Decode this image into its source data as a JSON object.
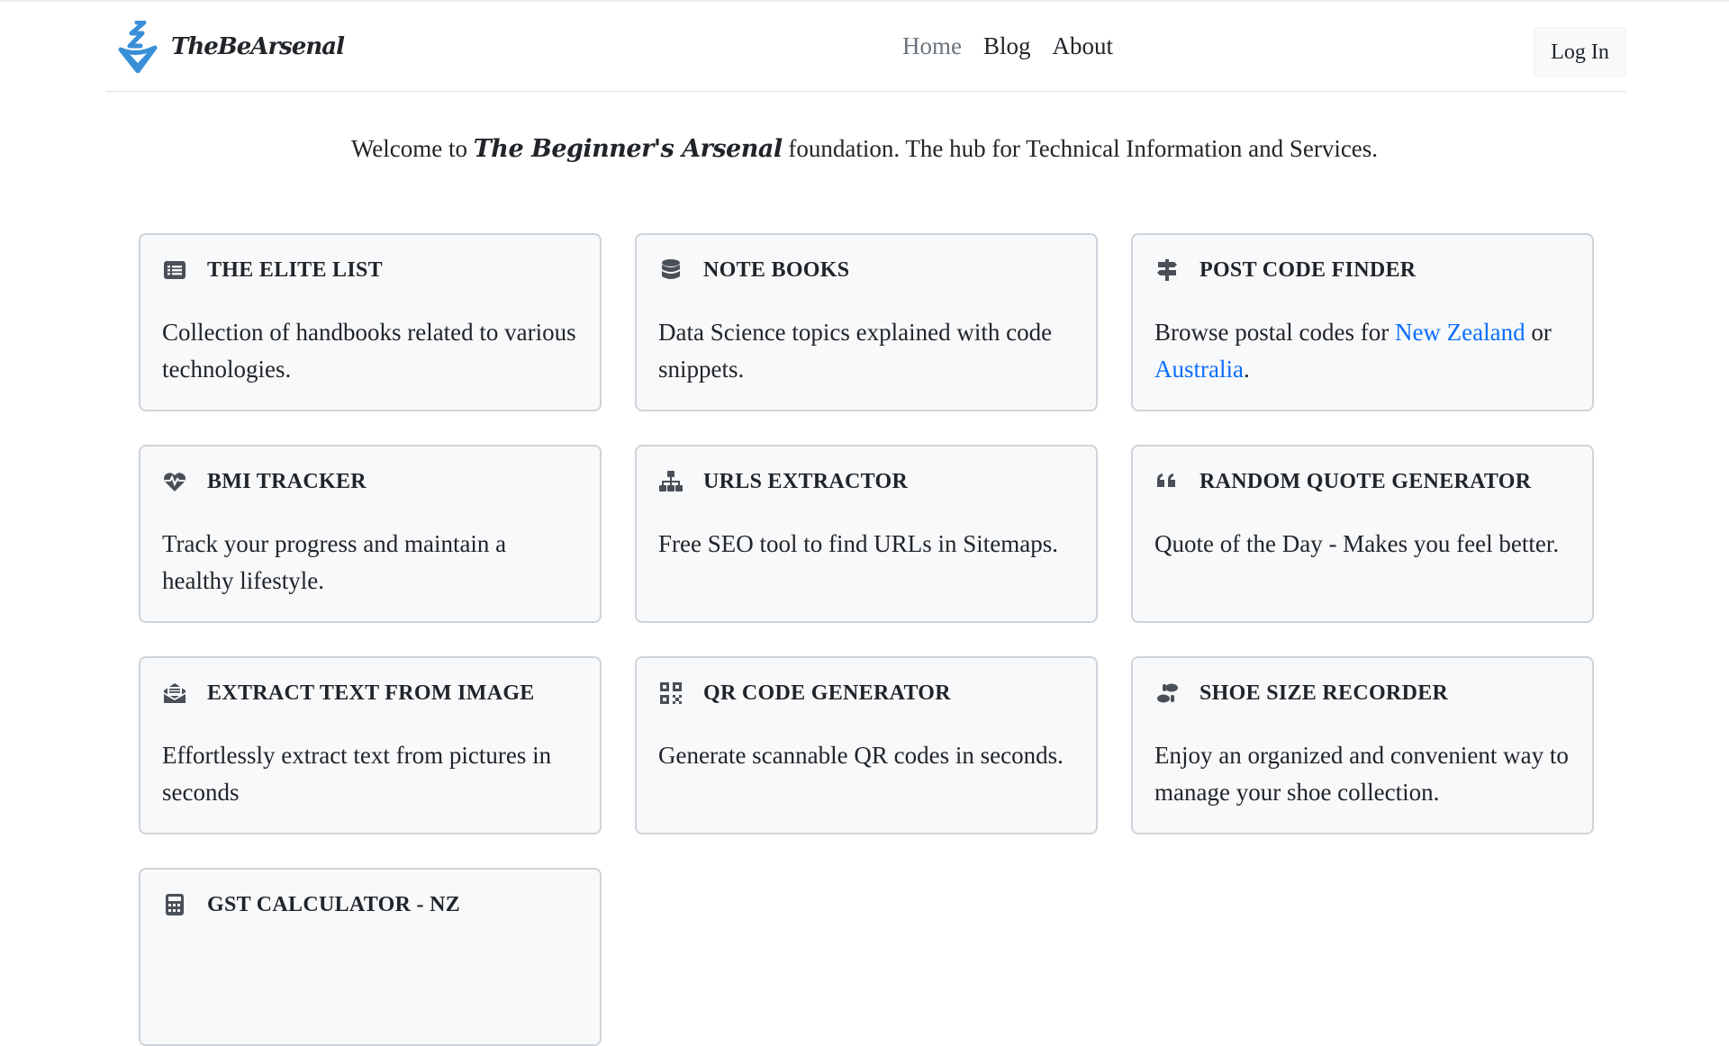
{
  "header": {
    "brand": "TheBeArsenal",
    "nav": [
      "Home",
      "Blog",
      "About"
    ],
    "login_label": "Log In"
  },
  "welcome": {
    "prefix": "Welcome to ",
    "brand": "The Beginner's Arsenal",
    "suffix": " foundation. The hub for Technical Information and Services."
  },
  "cards": [
    {
      "title": "THE ELITE LIST",
      "icon": "list-icon",
      "text": "Collection of handbooks related to various technologies."
    },
    {
      "title": "NOTE BOOKS",
      "icon": "database-icon",
      "text": "Data Science topics explained with code snippets."
    },
    {
      "title": "POST CODE FINDER",
      "icon": "signs-post-icon",
      "text_before": "Browse postal codes for ",
      "link1": "New Zealand",
      "text_mid": " or ",
      "link2": "Australia",
      "text_after": "."
    },
    {
      "title": "BMI TRACKER",
      "icon": "heart-pulse-icon",
      "text": "Track your progress and maintain a healthy lifestyle."
    },
    {
      "title": "URLS EXTRACTOR",
      "icon": "sitemap-icon",
      "text": "Free SEO tool to find URLs in Sitemaps."
    },
    {
      "title": "RANDOM QUOTE GENERATOR",
      "icon": "quote-left-icon",
      "text": "Quote of the Day - Makes you feel better."
    },
    {
      "title": "EXTRACT TEXT FROM IMAGE",
      "icon": "envelope-open-text-icon",
      "text": "Effortlessly extract text from pictures in seconds"
    },
    {
      "title": "QR CODE GENERATOR",
      "icon": "qrcode-icon",
      "text": "Generate scannable QR codes in seconds."
    },
    {
      "title": "SHOE SIZE RECORDER",
      "icon": "shoe-prints-icon",
      "text": "Enjoy an organized and convenient way to manage your shoe collection."
    },
    {
      "title": "GST CALCULATOR - NZ",
      "icon": "calculator-icon",
      "text": ""
    }
  ],
  "colors": {
    "link": "#0d6efd",
    "card_bg": "#f8f9fa",
    "card_border": "#ced4da",
    "logo": "#3a8fd9"
  }
}
